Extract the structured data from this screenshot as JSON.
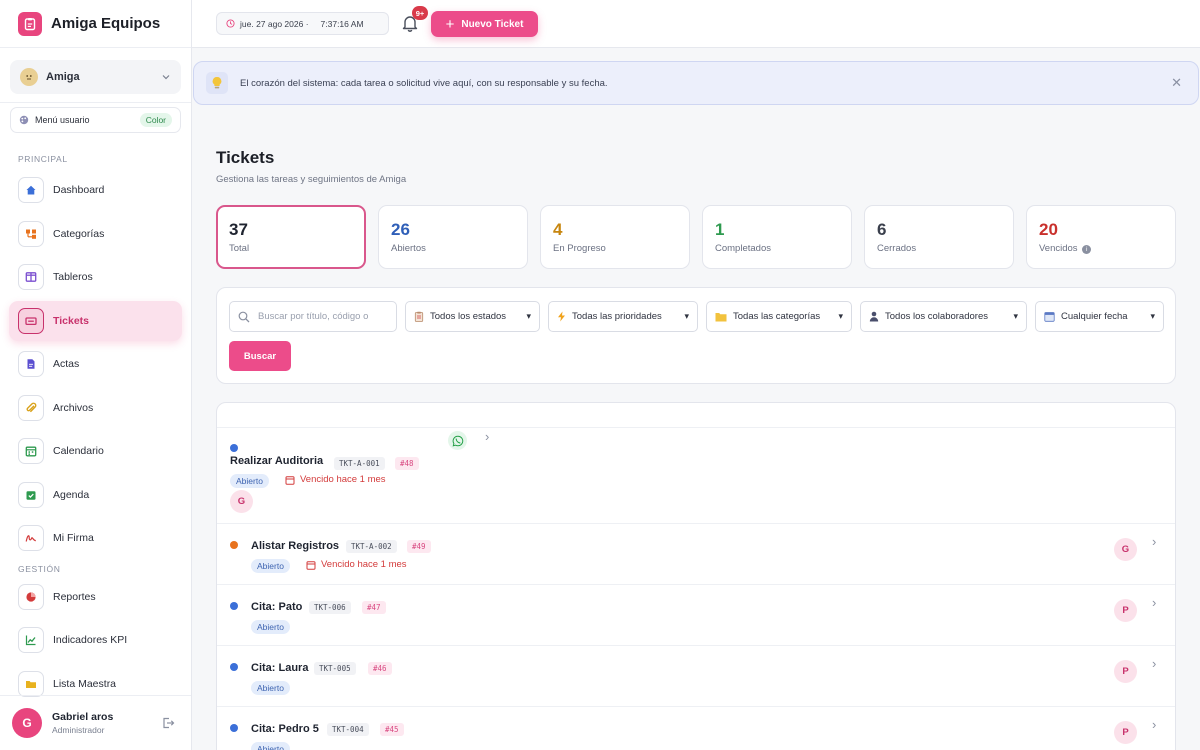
{
  "app": {
    "name": "Amiga Equipos"
  },
  "workspace": {
    "name": "Amiga"
  },
  "user_menu": {
    "label": "Menú usuario",
    "badge": "Color"
  },
  "sections": {
    "principal": "PRINCIPAL",
    "gestion": "GESTIÓN"
  },
  "nav": {
    "principal": [
      {
        "label": "Dashboard",
        "icon": "home-icon"
      },
      {
        "label": "Categorías",
        "icon": "category-icon"
      },
      {
        "label": "Tableros",
        "icon": "board-icon"
      },
      {
        "label": "Tickets",
        "icon": "ticket-icon",
        "active": true
      },
      {
        "label": "Actas",
        "icon": "document-icon"
      },
      {
        "label": "Archivos",
        "icon": "paperclip-icon"
      },
      {
        "label": "Calendario",
        "icon": "calendar-icon"
      },
      {
        "label": "Agenda",
        "icon": "agenda-icon"
      },
      {
        "label": "Mi Firma",
        "icon": "signature-icon"
      }
    ],
    "gestion": [
      {
        "label": "Reportes",
        "icon": "pie-chart-icon"
      },
      {
        "label": "Indicadores KPI",
        "icon": "line-chart-icon"
      },
      {
        "label": "Lista Maestra",
        "icon": "folder-icon"
      }
    ]
  },
  "current_user": {
    "initial": "G",
    "name": "Gabriel aros",
    "role": "Administrador"
  },
  "topbar": {
    "date": "jue. 27 ago 2026 ·",
    "time": "7:37:16 AM",
    "notifications": "9+",
    "new_ticket": "Nuevo Ticket"
  },
  "banner": {
    "text": "El corazón del sistema: cada tarea o solicitud vive aquí, con su responsable y su fecha."
  },
  "page": {
    "title": "Tickets",
    "subtitle": "Gestiona las tareas y seguimientos de Amiga"
  },
  "stats": [
    {
      "value": "37",
      "label": "Total",
      "color": "#1f2430"
    },
    {
      "value": "26",
      "label": "Abiertos",
      "color": "#2f5fb8"
    },
    {
      "value": "4",
      "label": "En Progreso",
      "color": "#c7860f"
    },
    {
      "value": "1",
      "label": "Completados",
      "color": "#2e9a4f"
    },
    {
      "value": "6",
      "label": "Cerrados",
      "color": "#3a3f4c"
    },
    {
      "value": "20",
      "label": "Vencidos",
      "color": "#c9302c"
    }
  ],
  "filters": {
    "search_placeholder": "Buscar por título, código o",
    "status": "Todos los estados",
    "priority": "Todas las prioridades",
    "category": "Todas las categorías",
    "collaborator": "Todos los colaboradores",
    "date": "Cualquier fecha",
    "search_button": "Buscar"
  },
  "tickets": [
    {
      "title": "Realizar Auditoria",
      "code": "TKT-A-001",
      "number": "#48",
      "status": "Abierto",
      "overdue": "Vencido hace 1 mes",
      "assignee": "G",
      "dot": "#3b6fd8"
    },
    {
      "title": "Alistar Registros",
      "code": "TKT-A-002",
      "number": "#49",
      "status": "Abierto",
      "overdue": "Vencido hace 1 mes",
      "assignee": "G",
      "dot": "#e8731e"
    },
    {
      "title": "Cita: Pato",
      "code": "TKT-006",
      "number": "#47",
      "status": "Abierto",
      "assignee": "P",
      "dot": "#3b6fd8"
    },
    {
      "title": "Cita: Laura",
      "code": "TKT-005",
      "number": "#46",
      "status": "Abierto",
      "assignee": "P",
      "dot": "#3b6fd8"
    },
    {
      "title": "Cita: Pedro 5",
      "code": "TKT-004",
      "number": "#45",
      "status": "Abierto",
      "assignee": "P",
      "dot": "#3b6fd8"
    }
  ]
}
